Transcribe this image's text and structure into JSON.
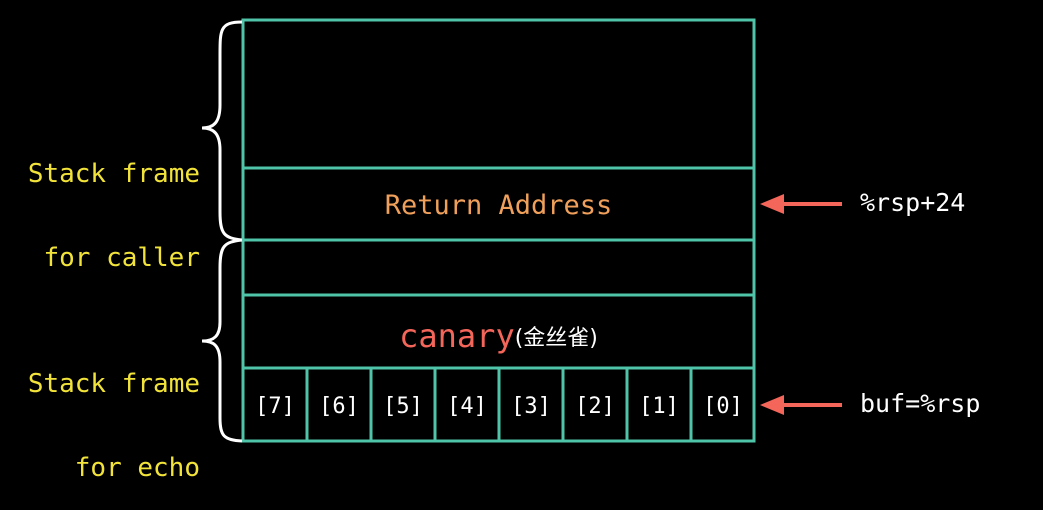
{
  "caller_frame_label": {
    "line1": "Stack frame",
    "line2": "for caller"
  },
  "echo_frame_label": {
    "line1": "Stack frame",
    "line2": "for echo"
  },
  "return_address": "Return Address",
  "canary": {
    "main": "canary",
    "note": "(金丝雀)"
  },
  "buffer_cells": [
    "[7]",
    "[6]",
    "[5]",
    "[4]",
    "[3]",
    "[2]",
    "[1]",
    "[0]"
  ],
  "pointers": {
    "return_addr": "%rsp+24",
    "buf": "buf=%rsp"
  },
  "colors": {
    "box_border": "#4fc4a8",
    "label_yellow": "#f2e33a",
    "return_text": "#f0a05a",
    "canary_text": "#f4655a",
    "arrow": "#f4655a"
  }
}
